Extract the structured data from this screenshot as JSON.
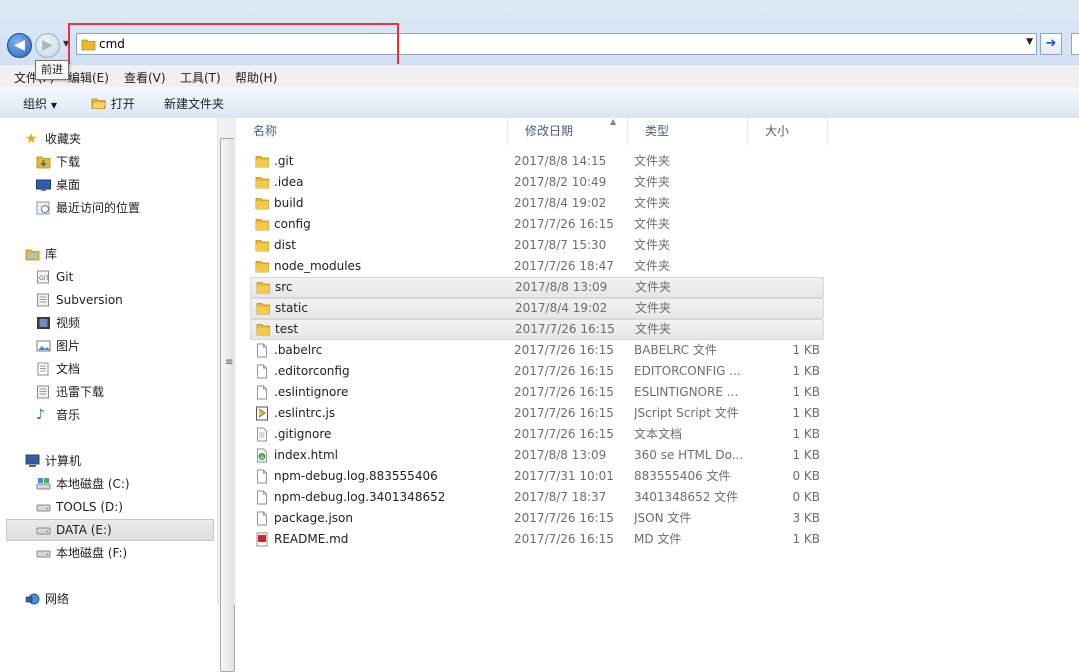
{
  "window": {
    "address_value": "cmd",
    "tooltip": "前进"
  },
  "menu": {
    "items": [
      "文件(F)",
      "编辑(E)",
      "查看(V)",
      "工具(T)",
      "帮助(H)"
    ],
    "tooltip_cover_text": "文件"
  },
  "toolbar": {
    "organize_label": "组织",
    "open_label": "打开",
    "new_folder_label": "新建文件夹"
  },
  "sidebar": {
    "favorites": {
      "label": "收藏夹",
      "items": [
        "下载",
        "桌面",
        "最近访问的位置"
      ]
    },
    "libraries": {
      "label": "库",
      "items": [
        "Git",
        "Subversion",
        "视频",
        "图片",
        "文档",
        "迅雷下载",
        "音乐"
      ]
    },
    "computer": {
      "label": "计算机",
      "items": [
        "本地磁盘 (C:)",
        "TOOLS (D:)",
        "DATA (E:)",
        "本地磁盘 (F:)"
      ],
      "selected": "DATA (E:)"
    },
    "network": {
      "label": "网络"
    }
  },
  "columns": {
    "name": "名称",
    "modified": "修改日期",
    "type": "类型",
    "size": "大小"
  },
  "files": [
    {
      "name": ".git",
      "modified": "2017/8/8 14:15",
      "type": "文件夹",
      "size": "",
      "icon": "folder-icon"
    },
    {
      "name": ".idea",
      "modified": "2017/8/2 10:49",
      "type": "文件夹",
      "size": "",
      "icon": "folder-icon"
    },
    {
      "name": "build",
      "modified": "2017/8/4 19:02",
      "type": "文件夹",
      "size": "",
      "icon": "folder-icon"
    },
    {
      "name": "config",
      "modified": "2017/7/26 16:15",
      "type": "文件夹",
      "size": "",
      "icon": "folder-icon"
    },
    {
      "name": "dist",
      "modified": "2017/8/7 15:30",
      "type": "文件夹",
      "size": "",
      "icon": "folder-icon"
    },
    {
      "name": "node_modules",
      "modified": "2017/7/26 18:47",
      "type": "文件夹",
      "size": "",
      "icon": "folder-icon"
    },
    {
      "name": "src",
      "modified": "2017/8/8 13:09",
      "type": "文件夹",
      "size": "",
      "icon": "folder-icon",
      "selected": true
    },
    {
      "name": "static",
      "modified": "2017/8/4 19:02",
      "type": "文件夹",
      "size": "",
      "icon": "folder-icon",
      "selected": true
    },
    {
      "name": "test",
      "modified": "2017/7/26 16:15",
      "type": "文件夹",
      "size": "",
      "icon": "folder-icon",
      "selected": true
    },
    {
      "name": ".babelrc",
      "modified": "2017/7/26 16:15",
      "type": "BABELRC 文件",
      "size": "1 KB",
      "icon": "file-icon"
    },
    {
      "name": ".editorconfig",
      "modified": "2017/7/26 16:15",
      "type": "EDITORCONFIG ...",
      "size": "1 KB",
      "icon": "file-icon"
    },
    {
      "name": ".eslintignore",
      "modified": "2017/7/26 16:15",
      "type": "ESLINTIGNORE ...",
      "size": "1 KB",
      "icon": "file-icon"
    },
    {
      "name": ".eslintrc.js",
      "modified": "2017/7/26 16:15",
      "type": "JScript Script 文件",
      "size": "1 KB",
      "icon": "script-file-icon"
    },
    {
      "name": ".gitignore",
      "modified": "2017/7/26 16:15",
      "type": "文本文档",
      "size": "1 KB",
      "icon": "text-file-icon"
    },
    {
      "name": "index.html",
      "modified": "2017/8/8 13:09",
      "type": "360 se HTML Do...",
      "size": "1 KB",
      "icon": "html-file-icon"
    },
    {
      "name": "npm-debug.log.883555406",
      "modified": "2017/7/31 10:01",
      "type": "883555406 文件",
      "size": "0 KB",
      "icon": "file-icon"
    },
    {
      "name": "npm-debug.log.3401348652",
      "modified": "2017/8/7 18:37",
      "type": "3401348652 文件",
      "size": "0 KB",
      "icon": "file-icon"
    },
    {
      "name": "package.json",
      "modified": "2017/7/26 16:15",
      "type": "JSON 文件",
      "size": "3 KB",
      "icon": "file-icon"
    },
    {
      "name": "README.md",
      "modified": "2017/7/26 16:15",
      "type": "MD 文件",
      "size": "1 KB",
      "icon": "pdf-file-icon"
    }
  ],
  "colors": {
    "highlight_box": "#e8323c",
    "folder": "#e8b830",
    "selection": "#e7e7e7"
  }
}
